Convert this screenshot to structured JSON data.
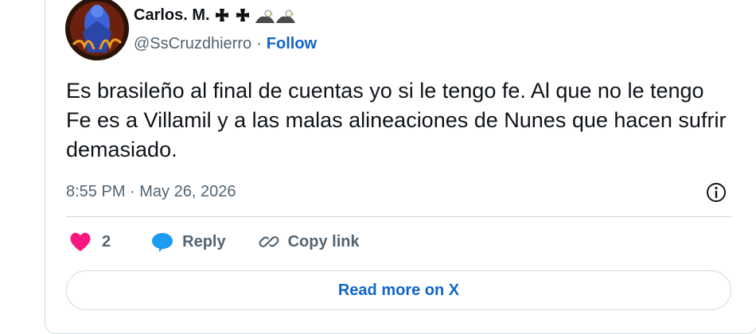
{
  "author": {
    "name": "Carlos. M.",
    "name_icons": [
      "cross-icon",
      "cross-icon",
      "eagle-emoji",
      "eagle-emoji"
    ],
    "handle": "@SsCruzdhierro",
    "separator": "·",
    "follow_label": "Follow"
  },
  "tweet": {
    "text": "Es brasileño al final de cuentas yo si le tengo fe. Al que no le tengo Fe es a Villamil y a las malas alineaciones de Nunes que hacen sufrir demasiado.",
    "timestamp": "8:55 PM · May 26, 2026"
  },
  "actions": {
    "like_count": "2",
    "reply_label": "Reply",
    "copy_label": "Copy link"
  },
  "read_more_label": "Read more on X",
  "colors": {
    "like": "#f91880",
    "reply": "#1d9bf0",
    "link": "#0f66c9",
    "muted": "#536471",
    "border": "#cfd9de"
  }
}
